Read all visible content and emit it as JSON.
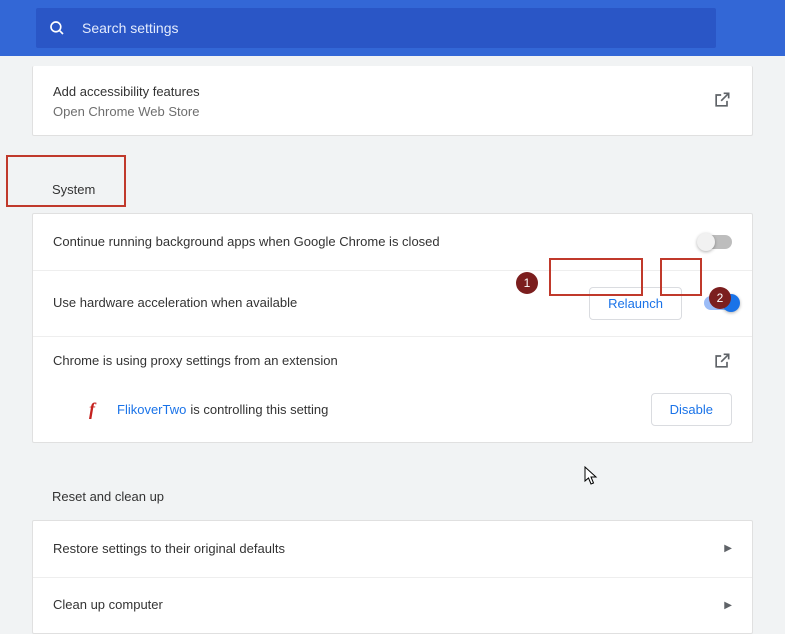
{
  "search": {
    "placeholder": "Search settings"
  },
  "accessibility": {
    "title": "Add accessibility features",
    "sub": "Open Chrome Web Store"
  },
  "sections": {
    "system": "System",
    "reset": "Reset and clean up"
  },
  "system": {
    "bg_apps": "Continue running background apps when Google Chrome is closed",
    "hw_accel": "Use hardware acceleration when available",
    "relaunch": "Relaunch",
    "proxy": "Chrome is using proxy settings from an extension",
    "ext_name": "FlikoverTwo",
    "ext_suffix": " is controlling this setting",
    "disable": "Disable"
  },
  "reset": {
    "restore": "Restore settings to their original defaults",
    "clean": "Clean up computer"
  },
  "anno": {
    "b1": "1",
    "b2": "2"
  }
}
